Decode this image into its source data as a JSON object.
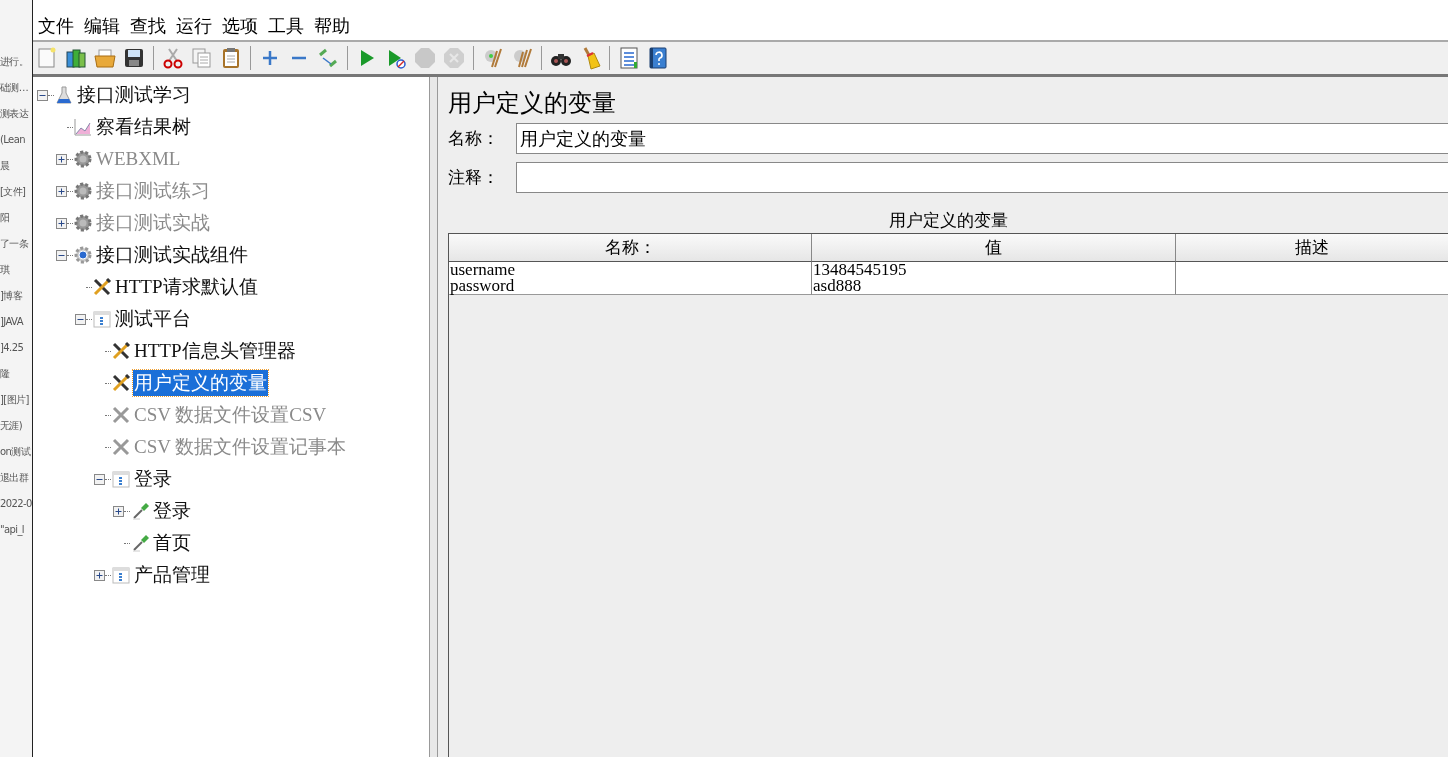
{
  "background_window": {
    "fragments": [
      "进行。",
      "础测…",
      "测表达",
      "(Lean",
      "晨",
      "[文件]",
      "阳",
      "了一条",
      "琪",
      "]博客",
      "]JAVA",
      "]4.25",
      "隆",
      "][图片]",
      "无涯)",
      "on测试",
      "退出群",
      "2022-0",
      "\"api_l"
    ]
  },
  "menu": [
    "文件",
    "编辑",
    "查找",
    "运行",
    "选项",
    "工具",
    "帮助"
  ],
  "toolbar": [
    {
      "kind": "new",
      "disabled": false
    },
    {
      "kind": "templates",
      "disabled": false
    },
    {
      "kind": "open",
      "disabled": false
    },
    {
      "kind": "save",
      "disabled": false
    },
    {
      "kind": "sep"
    },
    {
      "kind": "cut",
      "disabled": false
    },
    {
      "kind": "copy",
      "disabled": false
    },
    {
      "kind": "paste",
      "disabled": false
    },
    {
      "kind": "sep"
    },
    {
      "kind": "expand",
      "disabled": false
    },
    {
      "kind": "collapse",
      "disabled": false
    },
    {
      "kind": "toggle",
      "disabled": false
    },
    {
      "kind": "sep"
    },
    {
      "kind": "start",
      "disabled": false
    },
    {
      "kind": "start-no-timers",
      "disabled": false
    },
    {
      "kind": "stop",
      "disabled": true
    },
    {
      "kind": "shutdown",
      "disabled": true
    },
    {
      "kind": "sep"
    },
    {
      "kind": "clear",
      "disabled": false
    },
    {
      "kind": "clear-all",
      "disabled": false
    },
    {
      "kind": "sep"
    },
    {
      "kind": "search",
      "disabled": false
    },
    {
      "kind": "reset",
      "disabled": false
    },
    {
      "kind": "sep"
    },
    {
      "kind": "functions",
      "disabled": false
    },
    {
      "kind": "help",
      "disabled": false
    }
  ],
  "tree": [
    {
      "label": "接口测试学习",
      "kind": "testplan",
      "expanded": true,
      "disabled": false,
      "selected": false,
      "children": [
        {
          "label": "察看结果树",
          "kind": "listener",
          "disabled": false,
          "selected": false
        },
        {
          "label": "WEBXML",
          "kind": "threadgroup",
          "expanded": false,
          "disabled": true,
          "selected": false
        },
        {
          "label": "接口测试练习",
          "kind": "threadgroup",
          "expanded": false,
          "disabled": true,
          "selected": false
        },
        {
          "label": "接口测试实战",
          "kind": "threadgroup",
          "expanded": false,
          "disabled": true,
          "selected": false
        },
        {
          "label": "接口测试实战组件",
          "kind": "threadgroup",
          "expanded": true,
          "disabled": false,
          "selected": false,
          "children": [
            {
              "label": "HTTP请求默认值",
              "kind": "config",
              "disabled": false,
              "selected": false
            },
            {
              "label": "测试平台",
              "kind": "controller",
              "expanded": true,
              "disabled": false,
              "selected": false,
              "children": [
                {
                  "label": "HTTP信息头管理器",
                  "kind": "config",
                  "disabled": false,
                  "selected": false
                },
                {
                  "label": "用户定义的变量",
                  "kind": "config",
                  "disabled": false,
                  "selected": true
                },
                {
                  "label": "CSV 数据文件设置CSV",
                  "kind": "config",
                  "disabled": true,
                  "selected": false
                },
                {
                  "label": "CSV 数据文件设置记事本",
                  "kind": "config",
                  "disabled": true,
                  "selected": false
                },
                {
                  "label": "登录",
                  "kind": "controller",
                  "expanded": true,
                  "disabled": false,
                  "selected": false,
                  "children": [
                    {
                      "label": "登录",
                      "kind": "sampler",
                      "expanded": false,
                      "disabled": false,
                      "selected": false
                    },
                    {
                      "label": "首页",
                      "kind": "sampler",
                      "disabled": false,
                      "selected": false
                    }
                  ]
                },
                {
                  "label": "产品管理",
                  "kind": "controller",
                  "expanded": false,
                  "disabled": false,
                  "selected": false
                }
              ]
            }
          ]
        }
      ]
    }
  ],
  "panel": {
    "title": "用户定义的变量",
    "name_label": "名称：",
    "name_value": "用户定义的变量",
    "comment_label": "注释：",
    "table": {
      "caption": "用户定义的变量",
      "columns": [
        "名称：",
        "值",
        "描述"
      ],
      "rows": [
        [
          "username",
          "13484545195"
        ],
        [
          "password",
          "asd888"
        ]
      ]
    }
  }
}
